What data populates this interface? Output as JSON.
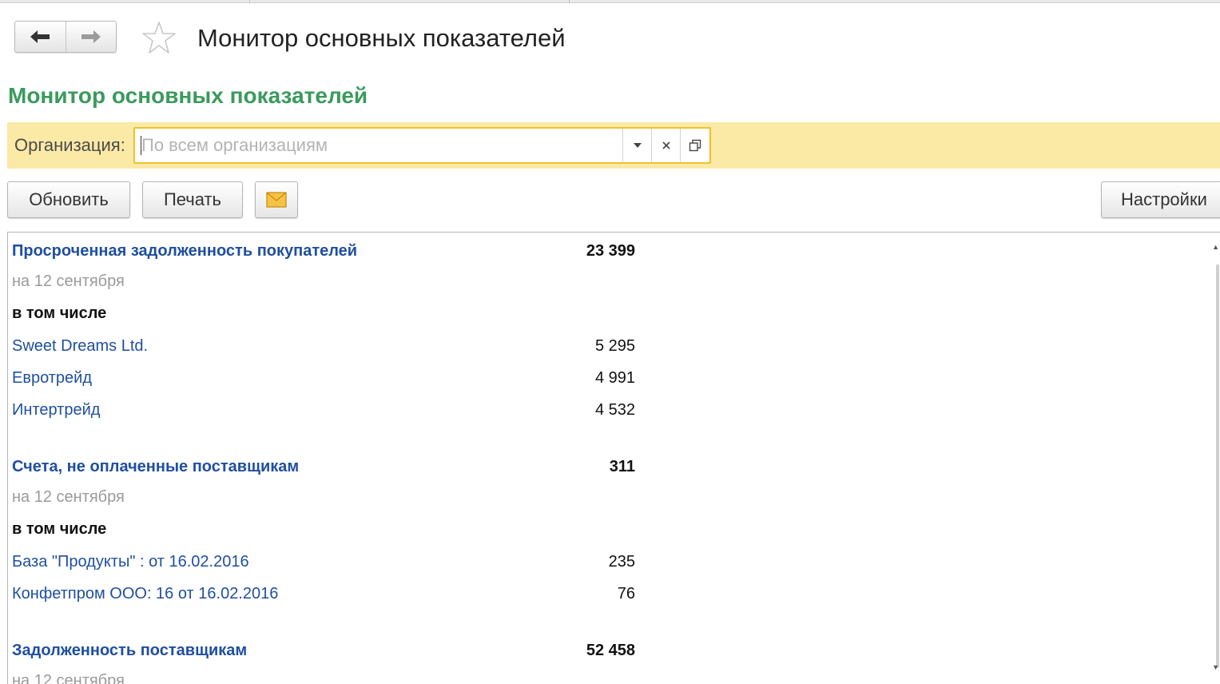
{
  "window": {
    "title": "Монитор основных показателей"
  },
  "form": {
    "title": "Монитор основных показателей"
  },
  "filter": {
    "label": "Организация:",
    "placeholder": "По всем организациям",
    "value": ""
  },
  "toolbar": {
    "refresh_label": "Обновить",
    "print_label": "Печать",
    "settings_label": "Настройки"
  },
  "report": {
    "sections": [
      {
        "title": "Просроченная задолженность покупателей",
        "total": "23 399",
        "date": "на 12 сентября",
        "including": "в том числе",
        "items": [
          {
            "name": "Sweet Dreams Ltd.",
            "value": "5 295"
          },
          {
            "name": "Евротрейд",
            "value": "4 991"
          },
          {
            "name": "Интертрейд",
            "value": "4 532"
          }
        ]
      },
      {
        "title": "Счета, не оплаченные поставщикам",
        "total": "311",
        "date": "на 12 сентября",
        "including": "в том числе",
        "items": [
          {
            "name": "База \"Продукты\" :  от 16.02.2016",
            "value": "235"
          },
          {
            "name": "Конфетпром ООО: 16 от 16.02.2016",
            "value": "76"
          }
        ]
      },
      {
        "title": "Задолженность поставщикам",
        "total": "52 458",
        "date": "на 12 сентября"
      }
    ]
  },
  "icons": {
    "back": "arrow-left-icon",
    "forward": "arrow-right-icon",
    "favorite": "star-icon",
    "dropdown": "chevron-down-icon",
    "clear": "close-icon",
    "open": "open-window-icon",
    "mail": "envelope-icon"
  },
  "colors": {
    "form_title": "#3a9a5c",
    "filter_bar": "#fbe9a6",
    "filter_border": "#f2c02e",
    "link": "#1f4fa0"
  }
}
